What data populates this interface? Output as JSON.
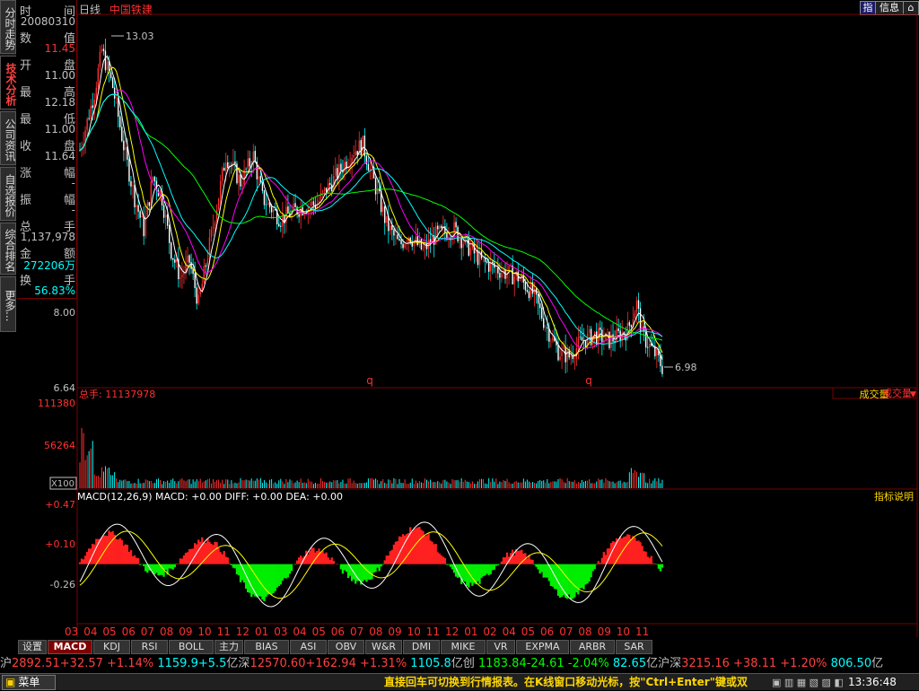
{
  "tabs_left": [
    "分时走势",
    "技术分析",
    "公司资讯",
    "自选报价",
    "综合排名",
    "更多..."
  ],
  "info": {
    "rows": [
      {
        "k": "时",
        "v": "间",
        "val": "20080310",
        "color": "#c0c0c0"
      },
      {
        "k": "数",
        "v": "值",
        "val": "11.45",
        "color": "#ff3030"
      },
      {
        "k": "开",
        "v": "盘",
        "val": "11.00",
        "color": "#c0c0c0"
      },
      {
        "k": "最",
        "v": "高",
        "val": "12.18",
        "color": "#c0c0c0"
      },
      {
        "k": "最",
        "v": "低",
        "val": "11.00",
        "color": "#c0c0c0"
      },
      {
        "k": "收",
        "v": "盘",
        "val": "11.64",
        "color": "#c0c0c0"
      },
      {
        "k": "涨",
        "v": "幅",
        "val": "-",
        "color": "#c0c0c0"
      },
      {
        "k": "振",
        "v": "幅",
        "val": "-",
        "color": "#c0c0c0"
      },
      {
        "k": "总",
        "v": "手",
        "val": "1,137,978",
        "color": "#c0c0c0"
      },
      {
        "k": "金",
        "v": "额",
        "val": "272206万",
        "color": "#00ffff"
      },
      {
        "k": "换",
        "v": "手",
        "val": "56.83%",
        "color": "#00ffff"
      }
    ]
  },
  "header": {
    "period": "日线",
    "stock": "中国铁建"
  },
  "top_buttons": {
    "zhi": "指",
    "info": "信息",
    "home": "⌂"
  },
  "price_chart": {
    "high_label": "13.03",
    "low_label": "6.98",
    "axis": [
      "8.00",
      "6.64"
    ],
    "q_marks": [
      "q",
      "q"
    ]
  },
  "volume": {
    "title": "总手: 11137978",
    "dropdown": "成交量",
    "axis": [
      "111380",
      "56264"
    ],
    "unit": "X100"
  },
  "macd": {
    "title": "MACD(12,26,9) MACD: +0.00 DIFF: +0.00 DEA: +0.00",
    "explain": "指标说明",
    "axis": [
      "+0.47",
      "+0.10",
      "-0.26"
    ]
  },
  "months": [
    "03",
    "04",
    "05",
    "06",
    "07",
    "08",
    "09",
    "10",
    "11",
    "12",
    "01",
    "03",
    "04",
    "05",
    "06",
    "07",
    "08",
    "09",
    "10",
    "11",
    "12",
    "01",
    "02",
    "04",
    "05",
    "06",
    "07",
    "08",
    "09",
    "10",
    "11"
  ],
  "indicator_tabs": [
    "设置",
    "MACD",
    "KDJ",
    "RSI",
    "BOLL",
    "主力",
    "BIAS",
    "ASI",
    "OBV",
    "W&R",
    "DMI",
    "MIKE",
    "VR",
    "EXPMA",
    "ARBR",
    "SAR"
  ],
  "ticker": [
    {
      "t": "沪",
      "c": "#c0c0c0"
    },
    {
      "t": "2892.51",
      "c": "#ff4040"
    },
    {
      "t": "+32.57 +1.14%",
      "c": "#ff4040"
    },
    {
      "t": "  1159.9+5.5",
      "c": "#00ffff"
    },
    {
      "t": "亿",
      "c": "#c0c0c0"
    },
    {
      "t": "深",
      "c": "#c0c0c0"
    },
    {
      "t": "12570.60",
      "c": "#ff4040"
    },
    {
      "t": "+162.94 +1.31%",
      "c": "#ff4040"
    },
    {
      "t": "  1105.8",
      "c": "#00ffff"
    },
    {
      "t": "亿",
      "c": "#c0c0c0"
    },
    {
      "t": "创",
      "c": "#c0c0c0"
    },
    {
      "t": " 1183.84-24.61 -2.04%",
      "c": "#00ff00"
    },
    {
      "t": "  82.65",
      "c": "#00ffff"
    },
    {
      "t": "亿",
      "c": "#c0c0c0"
    },
    {
      "t": "沪深",
      "c": "#c0c0c0"
    },
    {
      "t": "3215.16 +38.11 +1.20%",
      "c": "#ff4040"
    },
    {
      "t": "  806.50",
      "c": "#00ffff"
    },
    {
      "t": "亿",
      "c": "#c0c0c0"
    }
  ],
  "status": {
    "menu": "菜单",
    "message": "直接回车可切换到行情报表。在K线窗口移动光标，按\"Ctrl+Enter\"键或双",
    "time": "13:36:48"
  },
  "colors": {
    "up": "#ff3030",
    "down": "#00ffff",
    "axis": "#7a0000",
    "macd_pos": "#ff2020",
    "macd_neg": "#00ee00"
  }
}
